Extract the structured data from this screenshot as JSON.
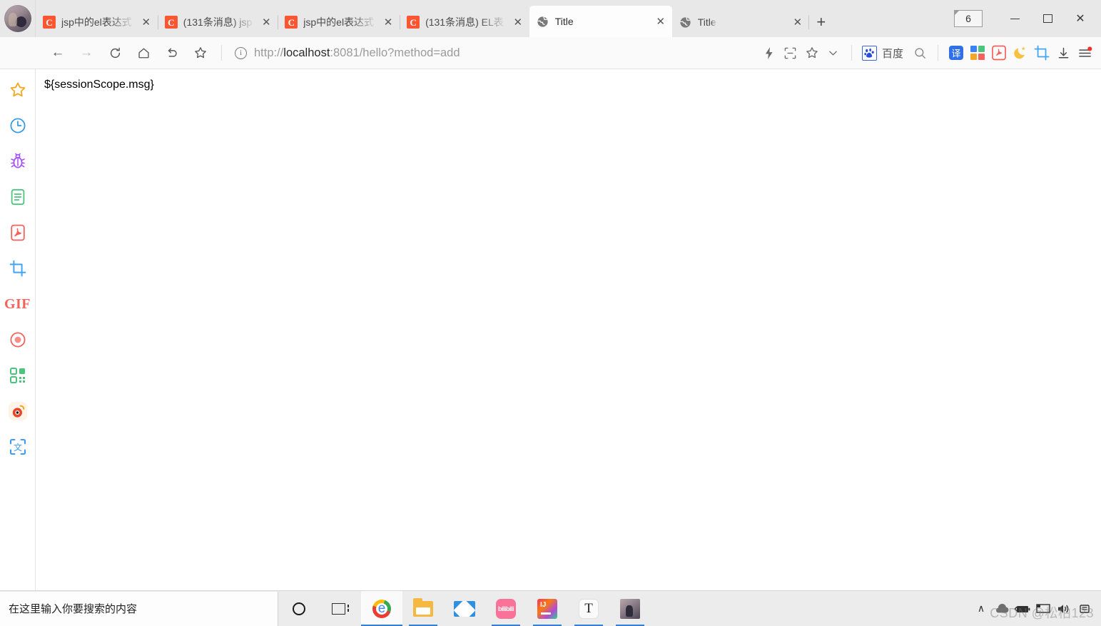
{
  "window": {
    "tab_count_badge": "6",
    "minimize_label": "–",
    "maximize_label": "□",
    "close_label": "✕",
    "new_tab_label": "+"
  },
  "tabs": [
    {
      "title": "jsp中的el表达式",
      "favicon": "csdn-favicon",
      "close_label": "✕",
      "active": false
    },
    {
      "title": "(131条消息) jsp",
      "favicon": "csdn-favicon",
      "close_label": "✕",
      "active": false
    },
    {
      "title": "jsp中的el表达式",
      "favicon": "csdn-favicon",
      "close_label": "✕",
      "active": false
    },
    {
      "title": "(131条消息) EL表",
      "favicon": "csdn-favicon",
      "close_label": "✕",
      "active": false
    },
    {
      "title": "Title",
      "favicon": "globe-favicon",
      "close_label": "✕",
      "active": true
    },
    {
      "title": "Title",
      "favicon": "globe-favicon",
      "close_label": "✕",
      "active": false
    }
  ],
  "toolbar": {
    "back_label": "←",
    "forward_label": "→",
    "reload_label": "⟳",
    "home_label": "⌂",
    "undo_label": "↶",
    "bookmark_label": "☆",
    "url_scheme": "http://",
    "url_host": "localhost",
    "url_rest": ":8081/hello?method=add",
    "url_full": "http://localhost:8081/hello?method=add",
    "info_icon_label": "i",
    "lightning_label": "⚡",
    "scan_label": "⬚",
    "star_label": "☆",
    "chevron_label": "⌄",
    "baidu_label": "百度",
    "search_label": "⌕",
    "translate_label": "译",
    "moon_label": "☽",
    "download_label": "↓",
    "menu_label": "≡"
  },
  "sidebar": {
    "items": [
      {
        "name": "star-icon",
        "color": "#f5a623"
      },
      {
        "name": "clock-icon",
        "color": "#3b9ae1"
      },
      {
        "name": "bug-icon",
        "color": "#a855f7"
      },
      {
        "name": "document-icon",
        "color": "#4cc47c"
      },
      {
        "name": "pdf-icon",
        "color": "#f4625c"
      },
      {
        "name": "crop-icon",
        "color": "#42a5f5"
      },
      {
        "name": "gif-icon",
        "color": "#f4625c",
        "text": "GIF"
      },
      {
        "name": "record-icon",
        "color": "#f4625c"
      },
      {
        "name": "qrcode-icon",
        "color": "#4cc47c"
      },
      {
        "name": "weibo-icon",
        "color": "#e8452c"
      },
      {
        "name": "translate-scan-icon",
        "color": "#3d9bf5"
      }
    ]
  },
  "page": {
    "content": "${sessionScope.msg}"
  },
  "taskbar": {
    "search_placeholder": "在这里输入你要搜索的内容",
    "cortana_label": "cortana-icon",
    "taskview_label": "task-view-icon",
    "apps": [
      {
        "name": "chrome",
        "running": true,
        "active": true
      },
      {
        "name": "file-explorer",
        "running": true,
        "active": false
      },
      {
        "name": "mail",
        "running": false,
        "active": false
      },
      {
        "name": "bilibili",
        "running": true,
        "active": false
      },
      {
        "name": "intellij-idea",
        "running": true,
        "active": false
      },
      {
        "name": "typora",
        "running": true,
        "active": false
      },
      {
        "name": "photos",
        "running": true,
        "active": false
      }
    ],
    "tray": {
      "chevron": "∧",
      "cloud": "cloud-icon",
      "battery": "battery-icon",
      "monitor": "monitor-icon",
      "volume": "🔊",
      "network": "network-icon"
    },
    "watermark": "CSDN @松柏123"
  },
  "colors": {
    "tabstrip_bg": "#e8e8e8",
    "toolbar_bg": "#fafafa",
    "active_tab_bg": "#fdfdfd",
    "taskbar_bg": "#ececec",
    "csdn_red": "#fc5531",
    "accent_blue": "#2f7fe0"
  }
}
